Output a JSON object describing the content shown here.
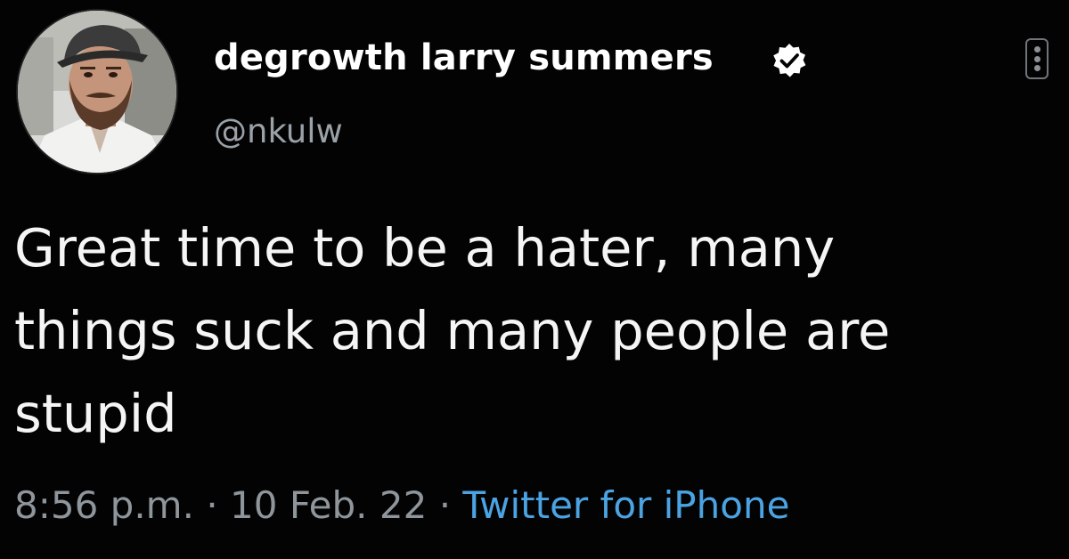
{
  "tweet": {
    "display_name": "degrowth larry summers",
    "handle": "@nkulw",
    "verified_icon": "verified-badge-icon",
    "more_icon": "more-options-icon",
    "text": "Great time to be a hater, many\nthings suck and many people are\nstupid",
    "time": "8:56 p.m.",
    "separator": "·",
    "date": "10 Feb. 22",
    "source": "Twitter for iPhone"
  },
  "colors": {
    "background": "#030303",
    "name": "#ffffff",
    "handle": "#9aa1a8",
    "body": "#f5f5f5",
    "meta": "#8e959b",
    "link": "#4ba3e3",
    "verified": "#ffffff"
  }
}
